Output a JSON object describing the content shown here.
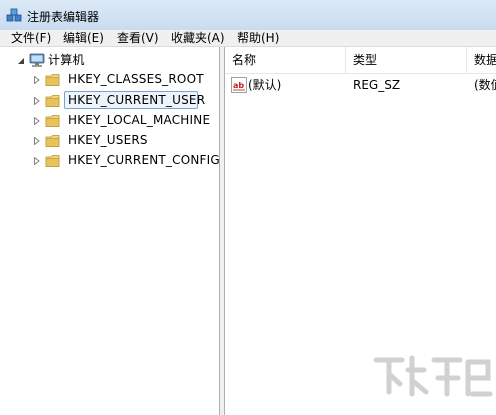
{
  "window": {
    "title": "注册表编辑器"
  },
  "menu": {
    "items": [
      "文件(F)",
      "编辑(E)",
      "查看(V)",
      "收藏夹(A)",
      "帮助(H)"
    ]
  },
  "tree": {
    "root": "计算机",
    "nodes": [
      {
        "label": "HKEY_CLASSES_ROOT"
      },
      {
        "label": "HKEY_CURRENT_USER",
        "selected": true
      },
      {
        "label": "HKEY_LOCAL_MACHINE"
      },
      {
        "label": "HKEY_USERS"
      },
      {
        "label": "HKEY_CURRENT_CONFIG"
      }
    ]
  },
  "list": {
    "columns": [
      "名称",
      "类型",
      "数据"
    ],
    "rows": [
      {
        "name": "(默认)",
        "type": "REG_SZ",
        "data": "(数值"
      }
    ]
  },
  "icons": {
    "app": "registry-editor-icon",
    "computer": "computer-icon",
    "folder": "folder-icon",
    "value": "string-value-icon",
    "expand": "expand-triangle-icon"
  },
  "colors": {
    "folder": "#e8c25a",
    "selection_border": "#7da2ce",
    "value_icon_text": "#c01f1f"
  }
}
